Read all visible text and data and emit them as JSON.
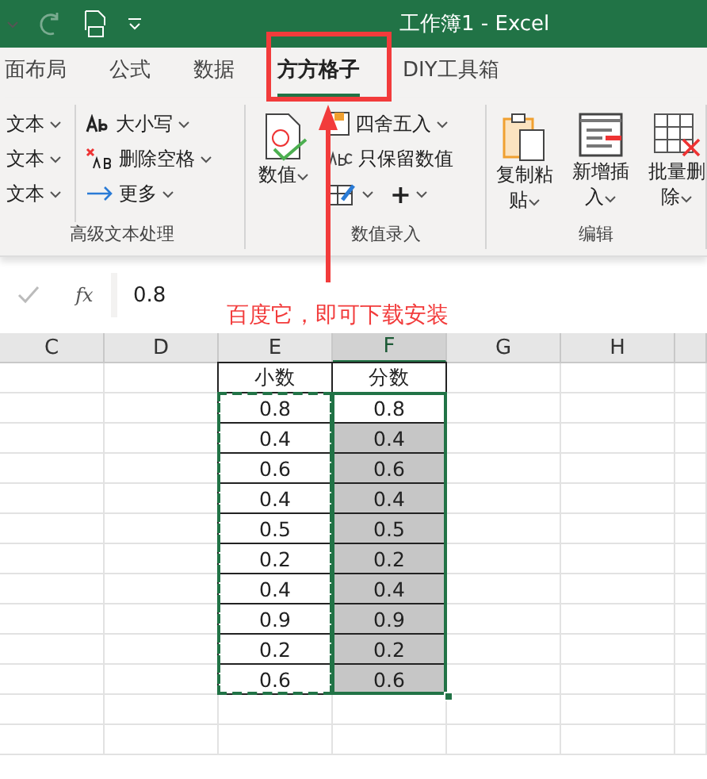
{
  "title_bar": {
    "title": "工作簿1  -  Excel",
    "redo_disabled": true
  },
  "tabs": [
    {
      "label": "面布局",
      "selected": false
    },
    {
      "label": "公式",
      "selected": false
    },
    {
      "label": "数据",
      "selected": false
    },
    {
      "label": "方方格子",
      "selected": true
    },
    {
      "label": "DIY工具箱",
      "selected": false
    }
  ],
  "ribbon": {
    "groups": [
      {
        "label": "高级文本处理",
        "columns": [
          [
            {
              "kind": "menu",
              "label": "文本"
            },
            {
              "kind": "menu",
              "label": "文本"
            },
            {
              "kind": "menu",
              "label": "文本"
            }
          ],
          [
            {
              "kind": "menu",
              "label": "大小写"
            },
            {
              "kind": "menu",
              "label": "删除空格"
            },
            {
              "kind": "menu",
              "label": "更多"
            }
          ]
        ]
      },
      {
        "label": "数值录入",
        "columns": [
          [
            {
              "kind": "large",
              "label": "数值"
            }
          ],
          [
            {
              "kind": "menu",
              "label": "四舍五入"
            },
            {
              "kind": "plain",
              "label": "只保留数值"
            },
            {
              "kind": "pair",
              "label": "+"
            }
          ]
        ]
      },
      {
        "label": "编辑",
        "columns": [
          [
            {
              "kind": "large",
              "label": "复制粘贴"
            }
          ],
          [
            {
              "kind": "large",
              "label": "新增插入"
            }
          ],
          [
            {
              "kind": "large",
              "label": "批量删除"
            }
          ]
        ]
      }
    ]
  },
  "formula_bar": {
    "fx_label": "fx",
    "value": "0.8"
  },
  "annotation": {
    "text": "百度它，即可下载安装"
  },
  "sheet": {
    "columns": [
      {
        "label": "C",
        "selected": false
      },
      {
        "label": "D",
        "selected": false
      },
      {
        "label": "E",
        "selected": false
      },
      {
        "label": "F",
        "selected": true
      },
      {
        "label": "G",
        "selected": false
      },
      {
        "label": "H",
        "selected": false
      }
    ],
    "rows": [
      {
        "e": {
          "text": "小数",
          "copied": false
        },
        "f": {
          "text": "分数",
          "selected": false,
          "active": false
        }
      },
      {
        "e": {
          "text": "0.8",
          "copied": true
        },
        "f": {
          "text": "0.8",
          "selected": true,
          "active": true
        }
      },
      {
        "e": {
          "text": "0.4",
          "copied": true
        },
        "f": {
          "text": "0.4",
          "selected": true,
          "active": false
        }
      },
      {
        "e": {
          "text": "0.6",
          "copied": true
        },
        "f": {
          "text": "0.6",
          "selected": true,
          "active": false
        }
      },
      {
        "e": {
          "text": "0.4",
          "copied": true
        },
        "f": {
          "text": "0.4",
          "selected": true,
          "active": false
        }
      },
      {
        "e": {
          "text": "0.5",
          "copied": true
        },
        "f": {
          "text": "0.5",
          "selected": true,
          "active": false
        }
      },
      {
        "e": {
          "text": "0.2",
          "copied": true
        },
        "f": {
          "text": "0.2",
          "selected": true,
          "active": false
        }
      },
      {
        "e": {
          "text": "0.4",
          "copied": true
        },
        "f": {
          "text": "0.4",
          "selected": true,
          "active": false
        }
      },
      {
        "e": {
          "text": "0.9",
          "copied": true
        },
        "f": {
          "text": "0.9",
          "selected": true,
          "active": false
        }
      },
      {
        "e": {
          "text": "0.2",
          "copied": true
        },
        "f": {
          "text": "0.2",
          "selected": true,
          "active": false
        }
      },
      {
        "e": {
          "text": "0.6",
          "copied": true
        },
        "f": {
          "text": "0.6",
          "selected": true,
          "active": false
        }
      }
    ]
  }
}
